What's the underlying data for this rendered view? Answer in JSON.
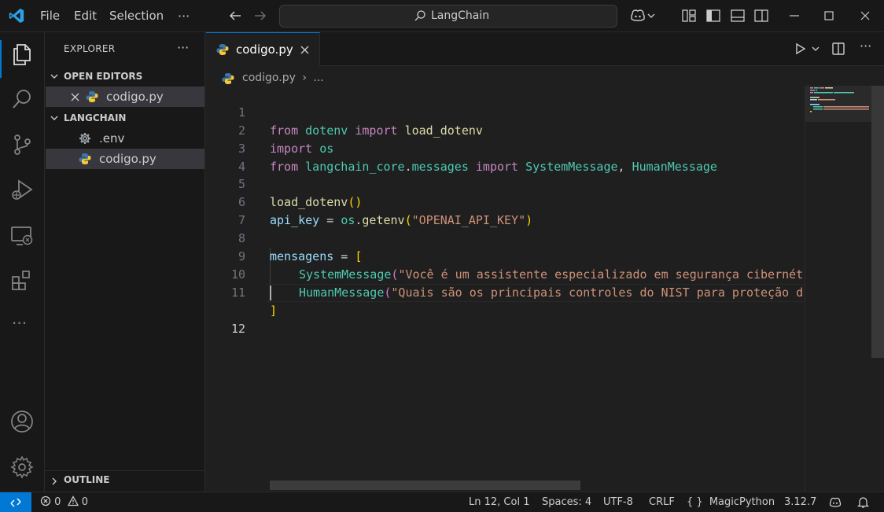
{
  "window": {
    "menu": [
      "File",
      "Edit",
      "Selection"
    ],
    "more": "···",
    "search_label": "LangChain"
  },
  "sidebar": {
    "title": "EXPLORER",
    "more": "···",
    "open_editors_label": "OPEN EDITORS",
    "open_editors": [
      {
        "label": "codigo.py"
      }
    ],
    "folder_label": "LANGCHAIN",
    "files": [
      {
        "label": ".env",
        "icon": "gear-icon"
      },
      {
        "label": "codigo.py",
        "icon": "python-icon"
      }
    ],
    "outline_label": "OUTLINE"
  },
  "editor": {
    "tab_label": "codigo.py",
    "breadcrumb_file": "codigo.py",
    "breadcrumb_more": "...",
    "line_numbers": [
      "1",
      "2",
      "3",
      "4",
      "5",
      "6",
      "7",
      "8",
      "9",
      "10",
      "11",
      "12"
    ],
    "code": {
      "l1": [
        "from",
        "dotenv",
        "import",
        "load_dotenv"
      ],
      "l2": [
        "import",
        "os"
      ],
      "l3": [
        "from",
        "langchain_core",
        ".",
        "messages",
        "import",
        "SystemMessage",
        ", ",
        "HumanMessage"
      ],
      "l5": [
        "load_dotenv",
        "()"
      ],
      "l6": [
        "api_key",
        " = ",
        "os",
        ".",
        "getenv",
        "(",
        "\"OPENAI_API_KEY\"",
        ")"
      ],
      "l8": [
        "mensagens",
        " = ",
        "["
      ],
      "l9": [
        "SystemMessage",
        "(",
        "\"Você é um assistente especializado em segurança cibernét"
      ],
      "l10": [
        "HumanMessage",
        "(",
        "\"Quais são os principais controles do NIST para proteção d"
      ],
      "l11": [
        "]"
      ]
    }
  },
  "status": {
    "errors": "0",
    "warnings": "0",
    "position": "Ln 12, Col 1",
    "spaces": "Spaces: 4",
    "encoding": "UTF-8",
    "eol": "CRLF",
    "language": "MagicPython",
    "version": "3.12.7"
  },
  "colors": {
    "accent": "#0078d4",
    "background": "#1f1f1f",
    "sidebar": "#181818"
  }
}
